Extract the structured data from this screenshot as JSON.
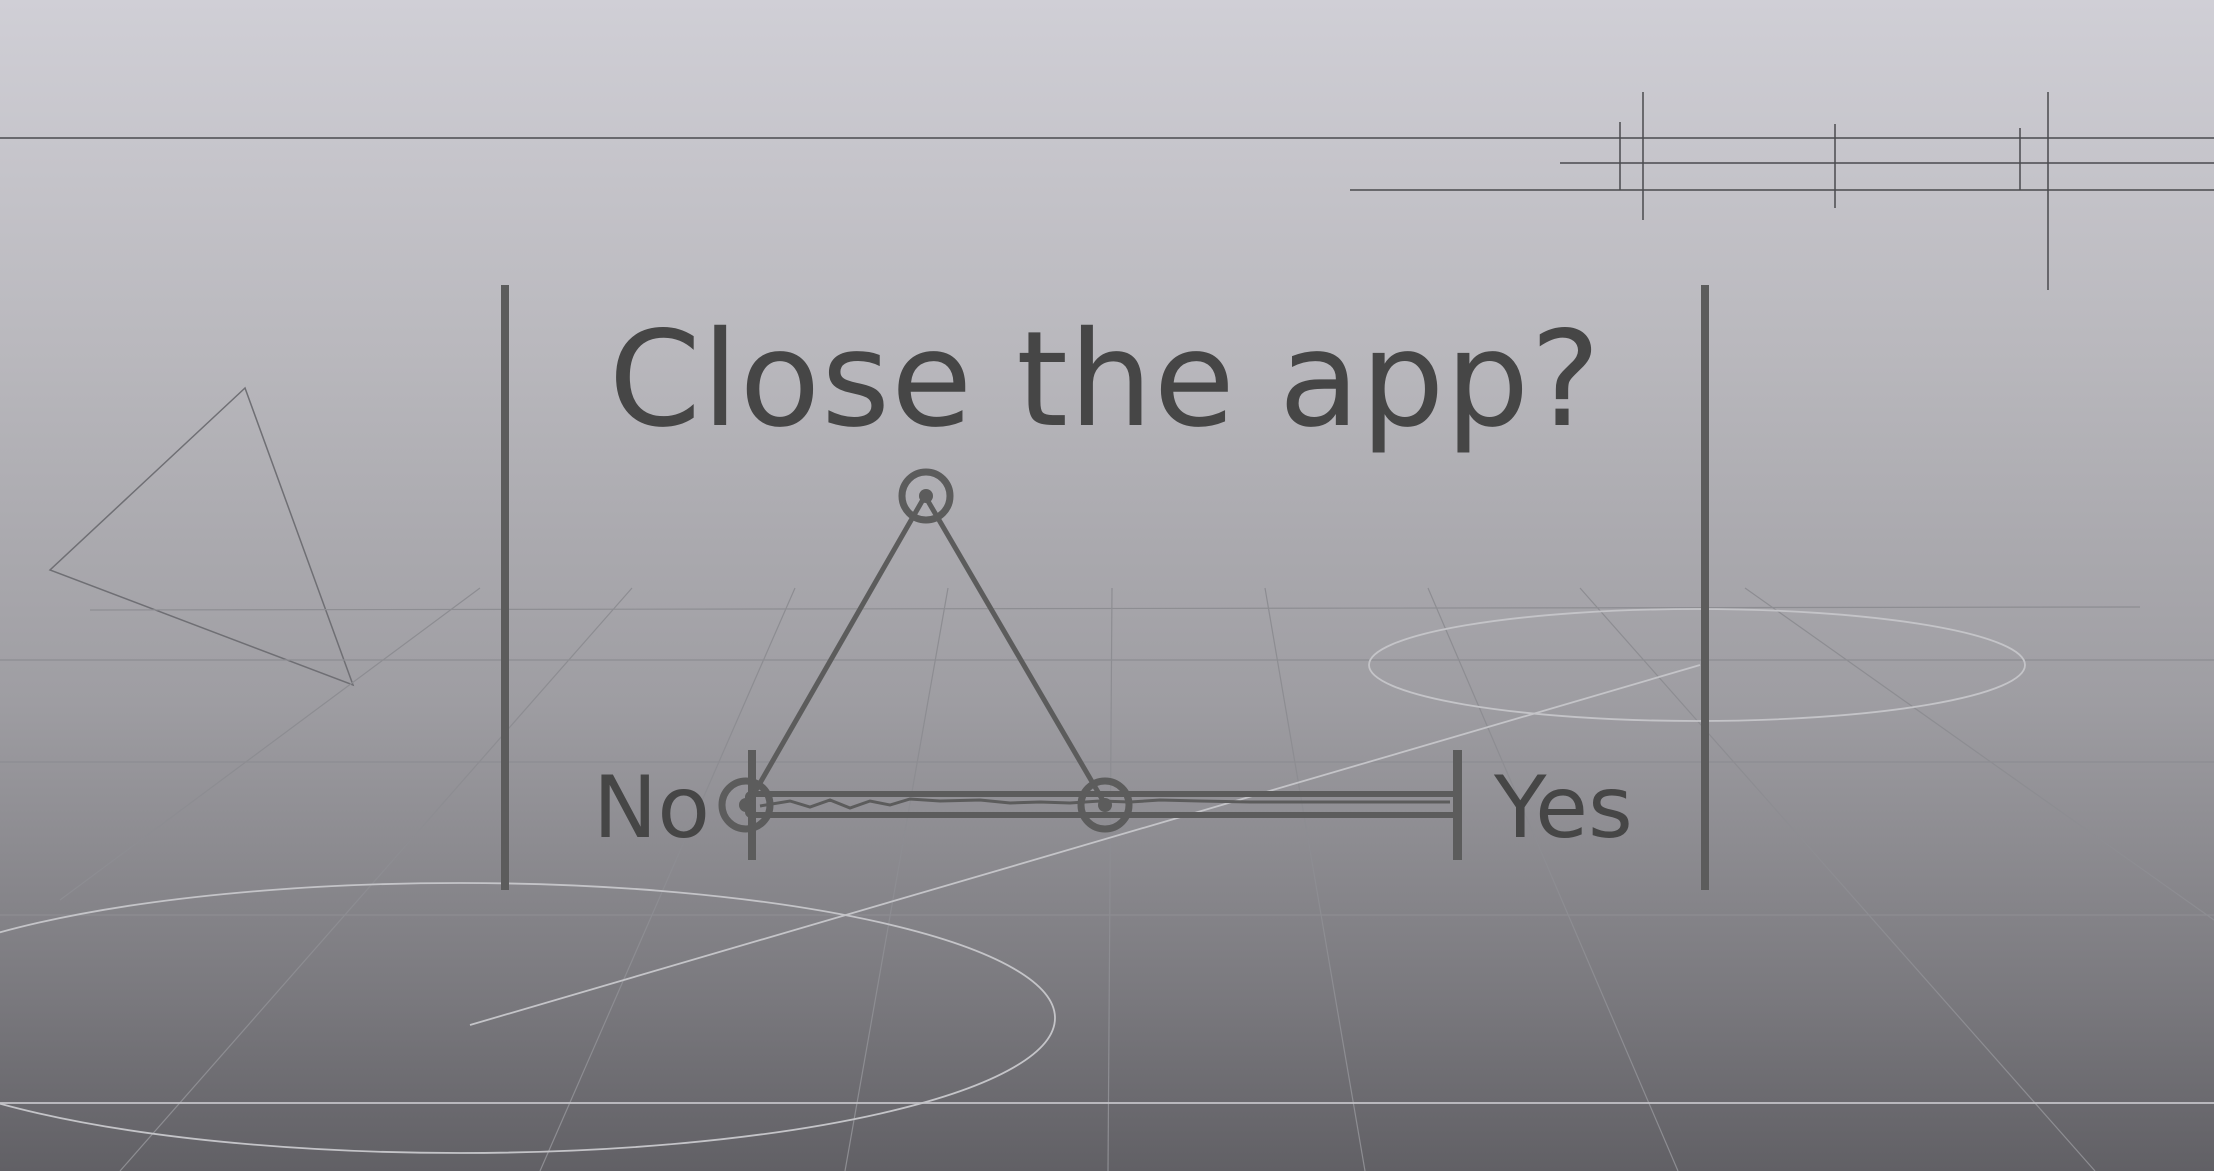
{
  "dialog": {
    "title": "Close the app?",
    "no_label": "No",
    "yes_label": "Yes"
  },
  "slider": {
    "value": 0.5,
    "min_label": "No",
    "max_label": "Yes"
  },
  "colors": {
    "background_top": "#d0cfd6",
    "background_bottom": "#616065",
    "ink": "#464646",
    "widget": "#5c5c5c"
  }
}
